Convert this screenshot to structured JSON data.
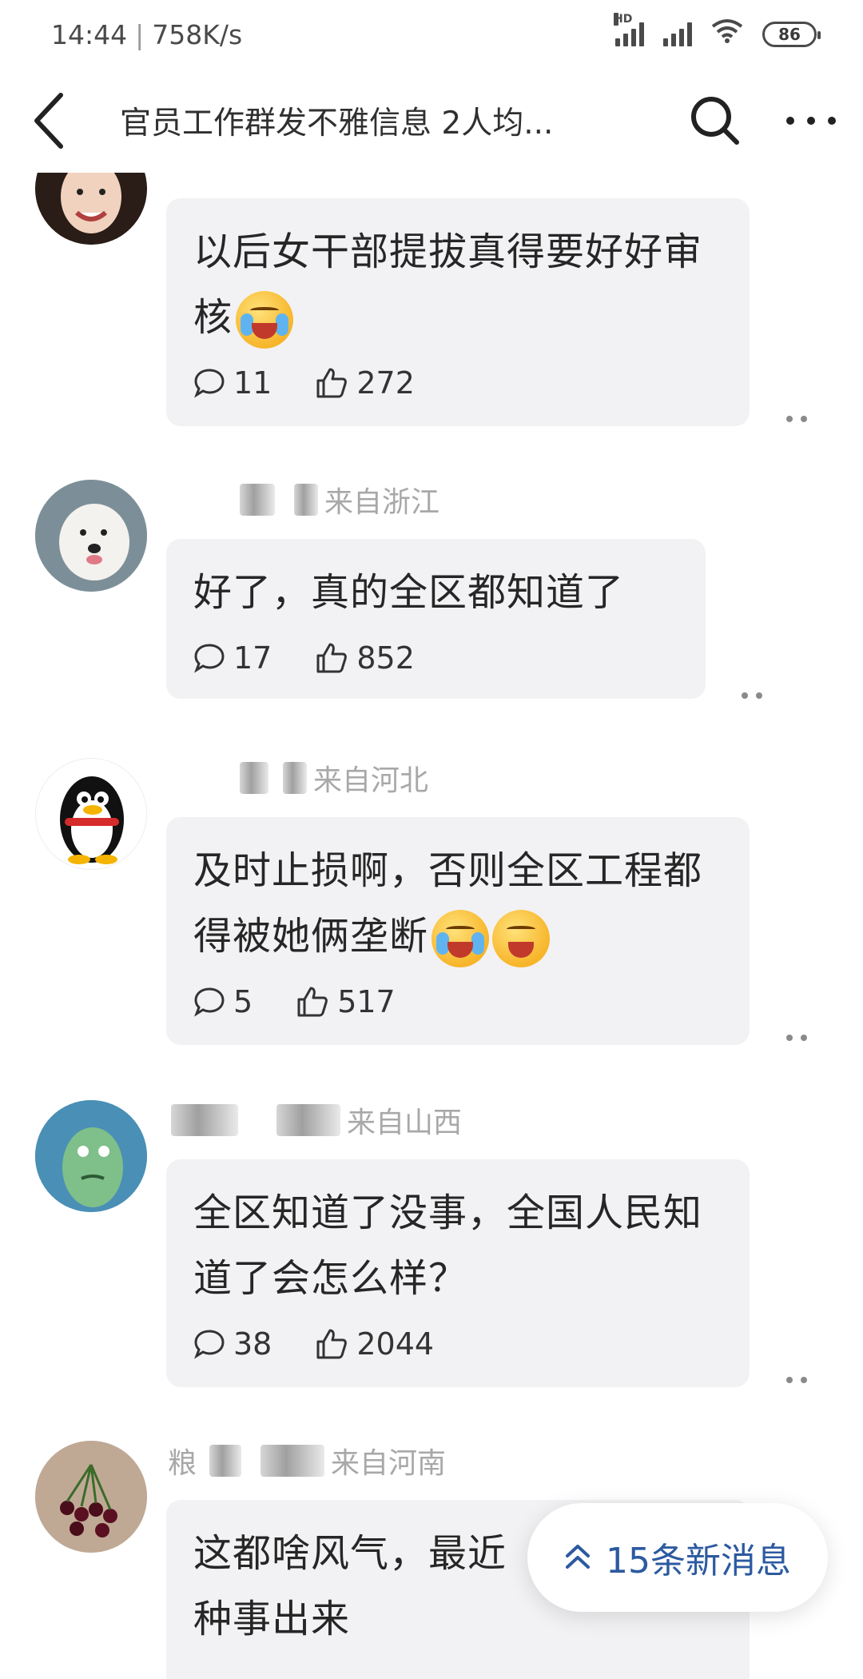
{
  "status_bar": {
    "time": "14:44",
    "separator": "|",
    "speed": "758K/s",
    "signal1_label": "HD",
    "battery": "86"
  },
  "nav": {
    "title": "官员工作群发不雅信息 2人均..."
  },
  "comments": [
    {
      "meta_suffix": "",
      "text": "以后女干部提拔真得要好好审核",
      "emojis": [
        "crying-laughing"
      ],
      "reply_count": "11",
      "like_count": "272"
    },
    {
      "meta_suffix": "来自浙江",
      "text": "好了，真的全区都知道了",
      "emojis": [],
      "reply_count": "17",
      "like_count": "852"
    },
    {
      "meta_suffix": "来自河北",
      "text": "及时止损啊，否则全区工程都得被她俩垄断",
      "emojis": [
        "crying-laughing",
        "grinning"
      ],
      "reply_count": "5",
      "like_count": "517"
    },
    {
      "meta_suffix": "来自山西",
      "text": "全区知道了没事，全国人民知道了会怎么样？",
      "emojis": [],
      "reply_count": "38",
      "like_count": "2044"
    },
    {
      "meta_prefix": "粮",
      "meta_suffix": "来自河南",
      "text": "这都啥风气，最近",
      "text_line2": "种事出来",
      "emojis": []
    }
  ],
  "new_messages": {
    "label": "15条新消息"
  },
  "colors": {
    "bubble_bg": "#f2f2f4",
    "accent": "#2c5aa0",
    "text": "#262626",
    "meta": "#a8a8a8"
  }
}
